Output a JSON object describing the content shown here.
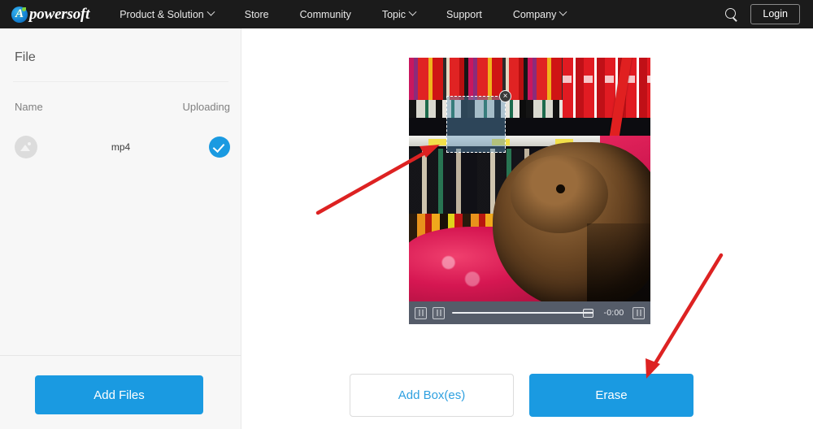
{
  "nav": {
    "brand": "powersoft",
    "brand_initial": "A",
    "items": [
      {
        "label": "Product & Solution",
        "has_caret": true
      },
      {
        "label": "Store",
        "has_caret": false
      },
      {
        "label": "Community",
        "has_caret": false
      },
      {
        "label": "Topic",
        "has_caret": true
      },
      {
        "label": "Support",
        "has_caret": false
      },
      {
        "label": "Company",
        "has_caret": true
      }
    ],
    "search_icon": "search-icon",
    "login_label": "Login"
  },
  "sidebar": {
    "title": "File",
    "col_name": "Name",
    "col_status": "Uploading",
    "rows": [
      {
        "thumb_icon": "image-placeholder-icon",
        "name": "mp4",
        "status_icon": "check-circle-icon"
      }
    ],
    "add_files_label": "Add Files"
  },
  "player": {
    "controls": [
      {
        "icon": "playback-button-icon"
      },
      {
        "icon": "playback-button-icon"
      }
    ],
    "time": "-0:00",
    "fullscreen_icon": "fullscreen-button-icon"
  },
  "selection": {
    "close_label": "×"
  },
  "actions": {
    "add_box_label": "Add Box(es)",
    "erase_label": "Erase"
  },
  "colors": {
    "accent_blue": "#1a9ae1",
    "nav_background": "#1b1b1b",
    "sidebar_background": "#f7f7f7",
    "annotation_red": "#e02020",
    "player_bar": "#555c69"
  }
}
